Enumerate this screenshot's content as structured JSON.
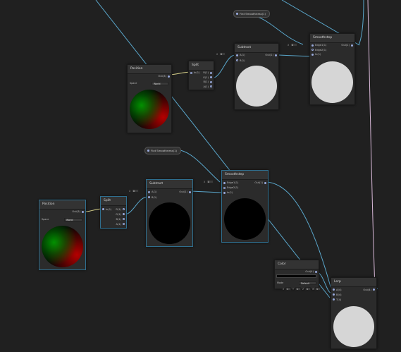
{
  "nodes": {
    "position_top": {
      "title": "Position",
      "out": "Out(3)",
      "space_label": "Space",
      "space_value": "World"
    },
    "split_top": {
      "title": "Split",
      "in": "In(1)",
      "r": "R(1)",
      "g": "G(1)",
      "b": "B(1)",
      "a": "A(1)"
    },
    "subtract_top": {
      "title": "Subtract",
      "a": "A(1)",
      "b": "B(1)",
      "out": "Out(1)"
    },
    "smoothstep_top": {
      "title": "Smoothstep",
      "edge1": "Edge1(1)",
      "edge2": "Edge2(1)",
      "in": "In(1)",
      "out": "Out(1)"
    },
    "position_bottom": {
      "title": "Position",
      "out": "Out(3)",
      "space_label": "Space",
      "space_value": "World"
    },
    "split_bottom": {
      "title": "Split",
      "in": "In(1)",
      "r": "R(1)",
      "g": "G(1)",
      "b": "B(1)",
      "a": "A(1)"
    },
    "subtract_bottom": {
      "title": "Subtract",
      "a": "A(1)",
      "b": "B(1)",
      "out": "Out(1)"
    },
    "smoothstep_bottom": {
      "title": "Smoothstep",
      "edge1": "Edge1(1)",
      "edge2": "Edge2(1)",
      "in": "In(1)",
      "out": "Out(1)"
    },
    "color": {
      "title": "Color",
      "out": "Out(4)",
      "mode_label": "Mode",
      "mode_value": "Default"
    },
    "lerp": {
      "title": "Lerp",
      "a": "A(4)",
      "b": "B(4)",
      "t": "T(4)",
      "out": "Out(4)"
    }
  },
  "properties": {
    "top": "Flat Smoothness(1)",
    "bottom": "Flat Smoothness(1)"
  },
  "inline_fields": {
    "subtract_top_b": {
      "tag": "X",
      "value": "0"
    },
    "subtract_bottom_b": {
      "tag": "X",
      "value": "0"
    },
    "smoothstep_top_edge": {
      "tag": "X",
      "value": "0"
    },
    "smoothstep_bottom_edge": {
      "tag": "X",
      "value": "0"
    },
    "lerp_x": {
      "tag": "X",
      "value": "1"
    },
    "lerp_y": {
      "tag": "Y",
      "value": "1"
    },
    "lerp_z": {
      "tag": "Z",
      "value": "1"
    },
    "lerp_w": {
      "tag": "W",
      "value": "1"
    }
  },
  "colors": {
    "wire_vector1": "#6fb4d6",
    "wire_vector3": "#d8d28a",
    "wire_vector4": "#d8b8d8",
    "selection": "#2f6f8f"
  }
}
